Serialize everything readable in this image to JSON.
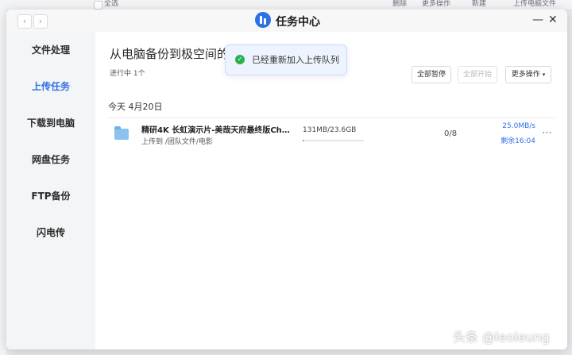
{
  "background_app": {
    "select_all": "全选",
    "delete": "删除",
    "more_actions": "更多操作",
    "new": "新建",
    "upload_computer_file": "上传电脑文件"
  },
  "window": {
    "title": "任务中心",
    "back_icon": "chevron-left-icon",
    "forward_icon": "chevron-right-icon",
    "minimize_icon": "minimize-icon",
    "close_icon": "close-icon"
  },
  "sidebar": {
    "items": [
      {
        "label": "文件处理",
        "active": false
      },
      {
        "label": "上传任务",
        "active": true
      },
      {
        "label": "下载到电脑",
        "active": false
      },
      {
        "label": "网盘任务",
        "active": false
      },
      {
        "label": "FTP备份",
        "active": false
      },
      {
        "label": "闪电传",
        "active": false
      }
    ]
  },
  "content": {
    "headline": "从电脑备份到极空间的文",
    "running": "进行中 1个",
    "buttons": {
      "pause_all": "全部暂停",
      "start_all": "全部开始",
      "more": "更多操作"
    },
    "date_group": "今天 4月20日",
    "tasks": [
      {
        "name": "精研4K 长虹演示片-美哉天府最终版Changhong...",
        "destination": "上传到 /团队文件/电影",
        "size": "131MB/23.6GB",
        "progress": 0.0055,
        "count": "0/8",
        "speed": "25.0MB/s",
        "remaining": "剩余16:04",
        "icon": "folder-icon"
      }
    ]
  },
  "toast": {
    "message": "已经重新加入上传队列",
    "icon": "check-circle-icon"
  },
  "watermark": "头条 @leoleung",
  "colors": {
    "accent": "#2f6fe4",
    "success": "#2bb24c"
  }
}
